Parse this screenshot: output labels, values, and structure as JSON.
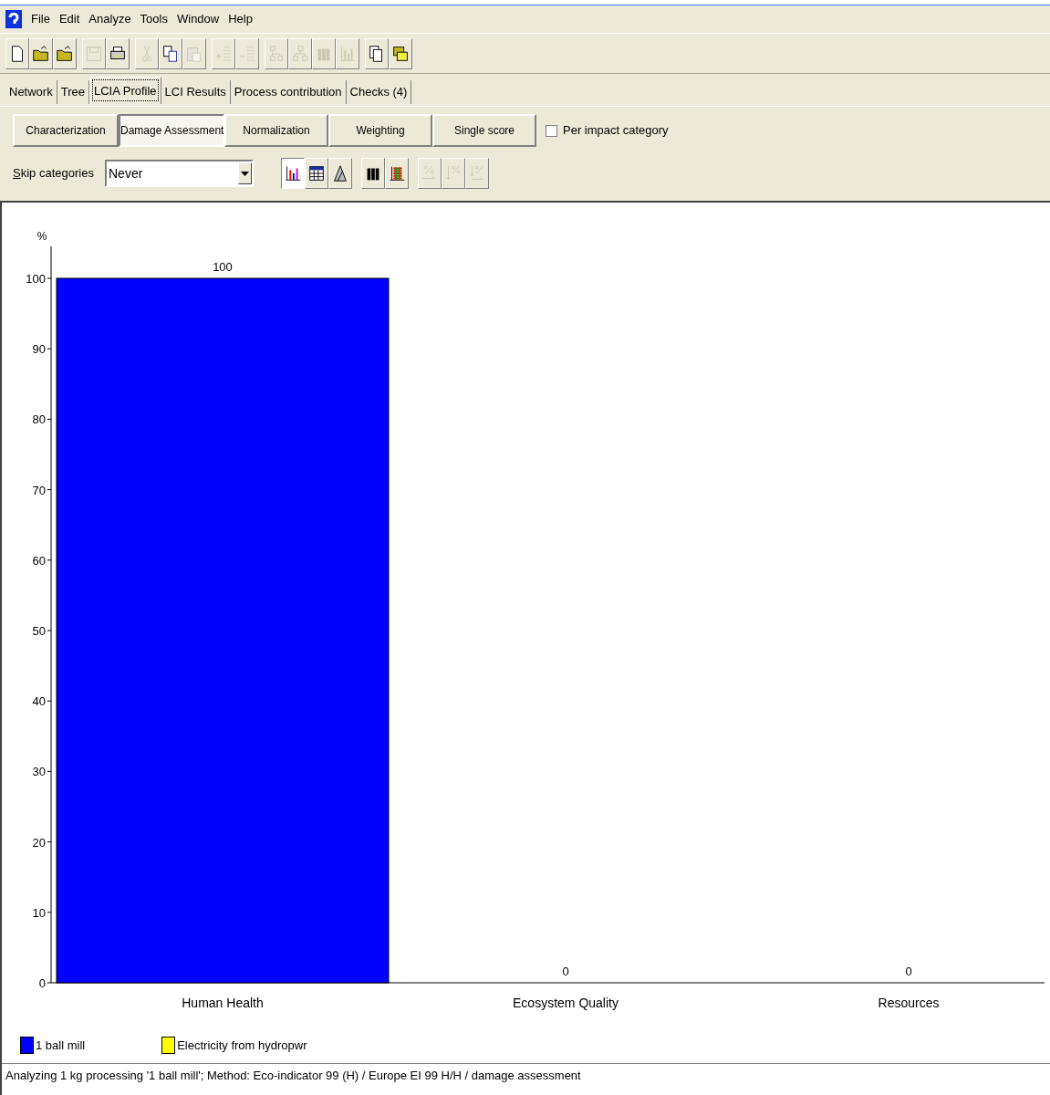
{
  "menu": [
    "File",
    "Edit",
    "Analyze",
    "Tools",
    "Window",
    "Help"
  ],
  "toolbar": [
    [
      {
        "kind": "new",
        "disabled": false
      },
      {
        "kind": "open",
        "disabled": false
      },
      {
        "kind": "open",
        "disabled": false
      }
    ],
    [
      {
        "kind": "save",
        "disabled": true
      },
      {
        "kind": "print",
        "disabled": false
      }
    ],
    [
      {
        "kind": "cut",
        "disabled": true
      },
      {
        "kind": "copy",
        "disabled": false
      },
      {
        "kind": "paste",
        "disabled": true
      }
    ],
    [
      {
        "kind": "addrows",
        "disabled": true
      },
      {
        "kind": "removerows",
        "disabled": true
      }
    ],
    [
      {
        "kind": "tree",
        "disabled": true
      },
      {
        "kind": "network",
        "disabled": true
      },
      {
        "kind": "bars",
        "disabled": true
      },
      {
        "kind": "chart",
        "disabled": true
      }
    ],
    [
      {
        "kind": "docs",
        "disabled": false
      },
      {
        "kind": "database",
        "disabled": false
      }
    ]
  ],
  "tabs": [
    {
      "label": "Network",
      "selected": false
    },
    {
      "label": "Tree",
      "selected": false
    },
    {
      "label": "LCIA Profile",
      "selected": true
    },
    {
      "label": "LCI Results",
      "selected": false
    },
    {
      "label": "Process contribution",
      "selected": false
    },
    {
      "label": "Checks (4)",
      "selected": false
    }
  ],
  "steps": [
    {
      "label": "Characterization",
      "selected": false
    },
    {
      "label": "Damage Assessment",
      "selected": true
    },
    {
      "label": "Normalization",
      "selected": false
    },
    {
      "label": "Weighting",
      "selected": false
    },
    {
      "label": "Single score",
      "selected": false
    }
  ],
  "per_impact_category": {
    "label": "Per impact category",
    "checked": false
  },
  "skip_categories": {
    "label": "Skip categories",
    "value": "Never"
  },
  "view_buttons": [
    [
      {
        "kind": "chart",
        "selected": true,
        "disabled": false
      },
      {
        "kind": "table",
        "selected": false,
        "disabled": false
      },
      {
        "kind": "triangle",
        "selected": false,
        "disabled": false
      }
    ],
    [
      {
        "kind": "bars",
        "selected": false,
        "disabled": false
      },
      {
        "kind": "stacked",
        "selected": false,
        "disabled": false
      }
    ],
    [
      {
        "kind": "percent",
        "selected": false,
        "disabled": true
      },
      {
        "kind": "percent_down",
        "selected": false,
        "disabled": true
      },
      {
        "kind": "percent_sort",
        "selected": false,
        "disabled": true
      }
    ]
  ],
  "chart_data": {
    "type": "bar",
    "ylabel": "%",
    "categories": [
      "Human Health",
      "Ecosystem Quality",
      "Resources"
    ],
    "stacked": true,
    "ylim": [
      0,
      100
    ],
    "yticks": [
      0,
      10,
      20,
      30,
      40,
      50,
      60,
      70,
      80,
      90,
      100
    ],
    "series": [
      {
        "name": "1 ball mill",
        "color": "#0000ff",
        "values": [
          100,
          0,
          0
        ]
      },
      {
        "name": "Electricity from hydropwr",
        "color": "#ffff00",
        "values": [
          0,
          0,
          0
        ]
      }
    ],
    "value_labels": [
      "100",
      "0",
      "0"
    ]
  },
  "status_bar": "Analyzing 1 kg processing '1 ball mill';  Method: Eco-indicator 99 (H) /  Europe EI 99 H/H / damage assessment"
}
